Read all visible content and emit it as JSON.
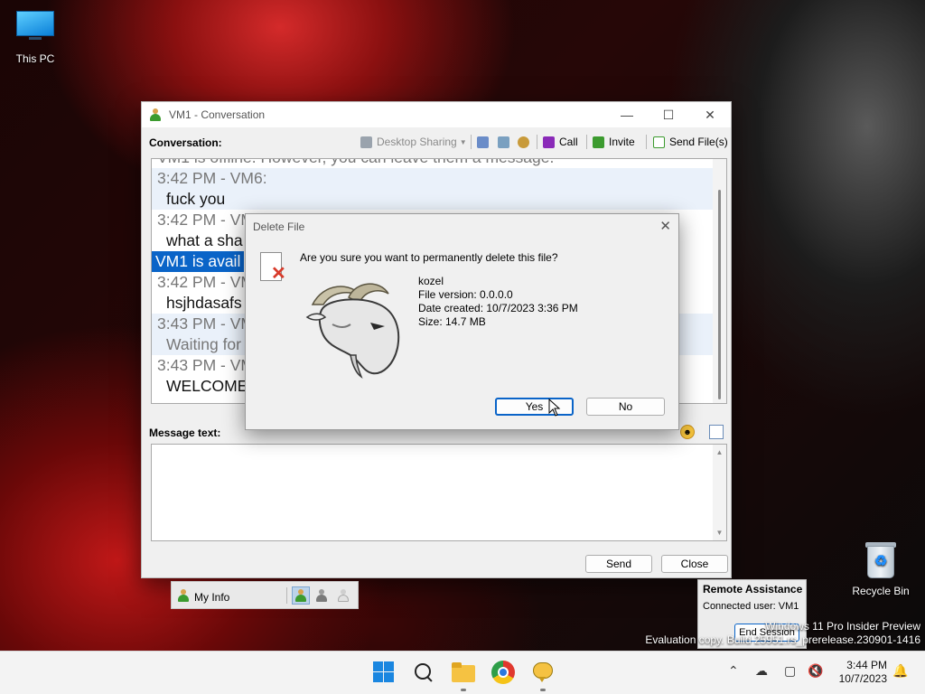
{
  "desktop": {
    "this_pc_label": "This PC",
    "recycle_bin_label": "Recycle Bin"
  },
  "conversation_window": {
    "title": "VM1 - Conversation",
    "conversation_label": "Conversation:",
    "toolbar": {
      "desktop_sharing": "Desktop Sharing",
      "call": "Call",
      "invite": "Invite",
      "send_files": "Send File(s)"
    },
    "chat_lines": [
      {
        "kind": "header",
        "text": "VM1 is offline. However, you can leave them a message."
      },
      {
        "kind": "header",
        "text": "3:42 PM - VM6:"
      },
      {
        "kind": "message",
        "text": "fuck you"
      },
      {
        "kind": "header",
        "text": "3:42 PM - VM6:"
      },
      {
        "kind": "message",
        "text": "what a sha"
      },
      {
        "kind": "system",
        "text": "VM1 is avail"
      },
      {
        "kind": "header",
        "text": "3:42 PM - VM6:"
      },
      {
        "kind": "message",
        "text": "hsjhdasafs"
      },
      {
        "kind": "header",
        "text": "3:43 PM - VM6:"
      },
      {
        "kind": "message_grey",
        "text": "Waiting for"
      },
      {
        "kind": "header",
        "text": "3:43 PM - VM6:"
      },
      {
        "kind": "message",
        "text": "WELCOME"
      }
    ],
    "message_text_label": "Message text:",
    "message_value": "",
    "send_button": "Send",
    "close_button": "Close"
  },
  "my_info": {
    "label": "My Info"
  },
  "delete_dialog": {
    "title": "Delete File",
    "question": "Are you sure you want to permanently delete this file?",
    "file_name": "kozel",
    "file_version": "File version: 0.0.0.0",
    "date_created": "Date created: 10/7/2023 3:36 PM",
    "size": "Size: 14.7 MB",
    "yes_button": "Yes",
    "no_button": "No"
  },
  "remote_assistance": {
    "title": "Remote Assistance",
    "connected_user": "Connected user: VM1",
    "end_session": "End Session"
  },
  "watermark": {
    "line1": "Windows 11 Pro Insider Preview",
    "line2": "Evaluation copy. Build 25951.rs_prerelease.230901-1416"
  },
  "taskbar": {
    "time": "3:44 PM",
    "date": "10/7/2023"
  },
  "colors": {
    "selection": "#0a64c8",
    "taskbar": "#f3f3f3",
    "dialog_bg": "#f0f0f0"
  }
}
